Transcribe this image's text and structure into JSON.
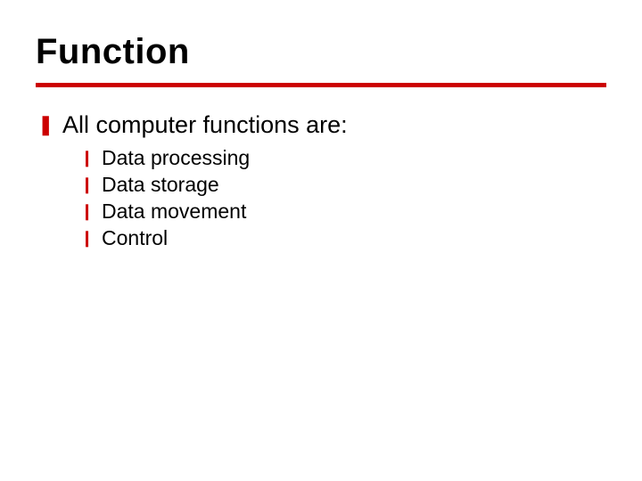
{
  "title": "Function",
  "bullets": {
    "main": "All computer functions are:",
    "subs": [
      "Data processing",
      "Data storage",
      "Data movement",
      "Control"
    ]
  }
}
